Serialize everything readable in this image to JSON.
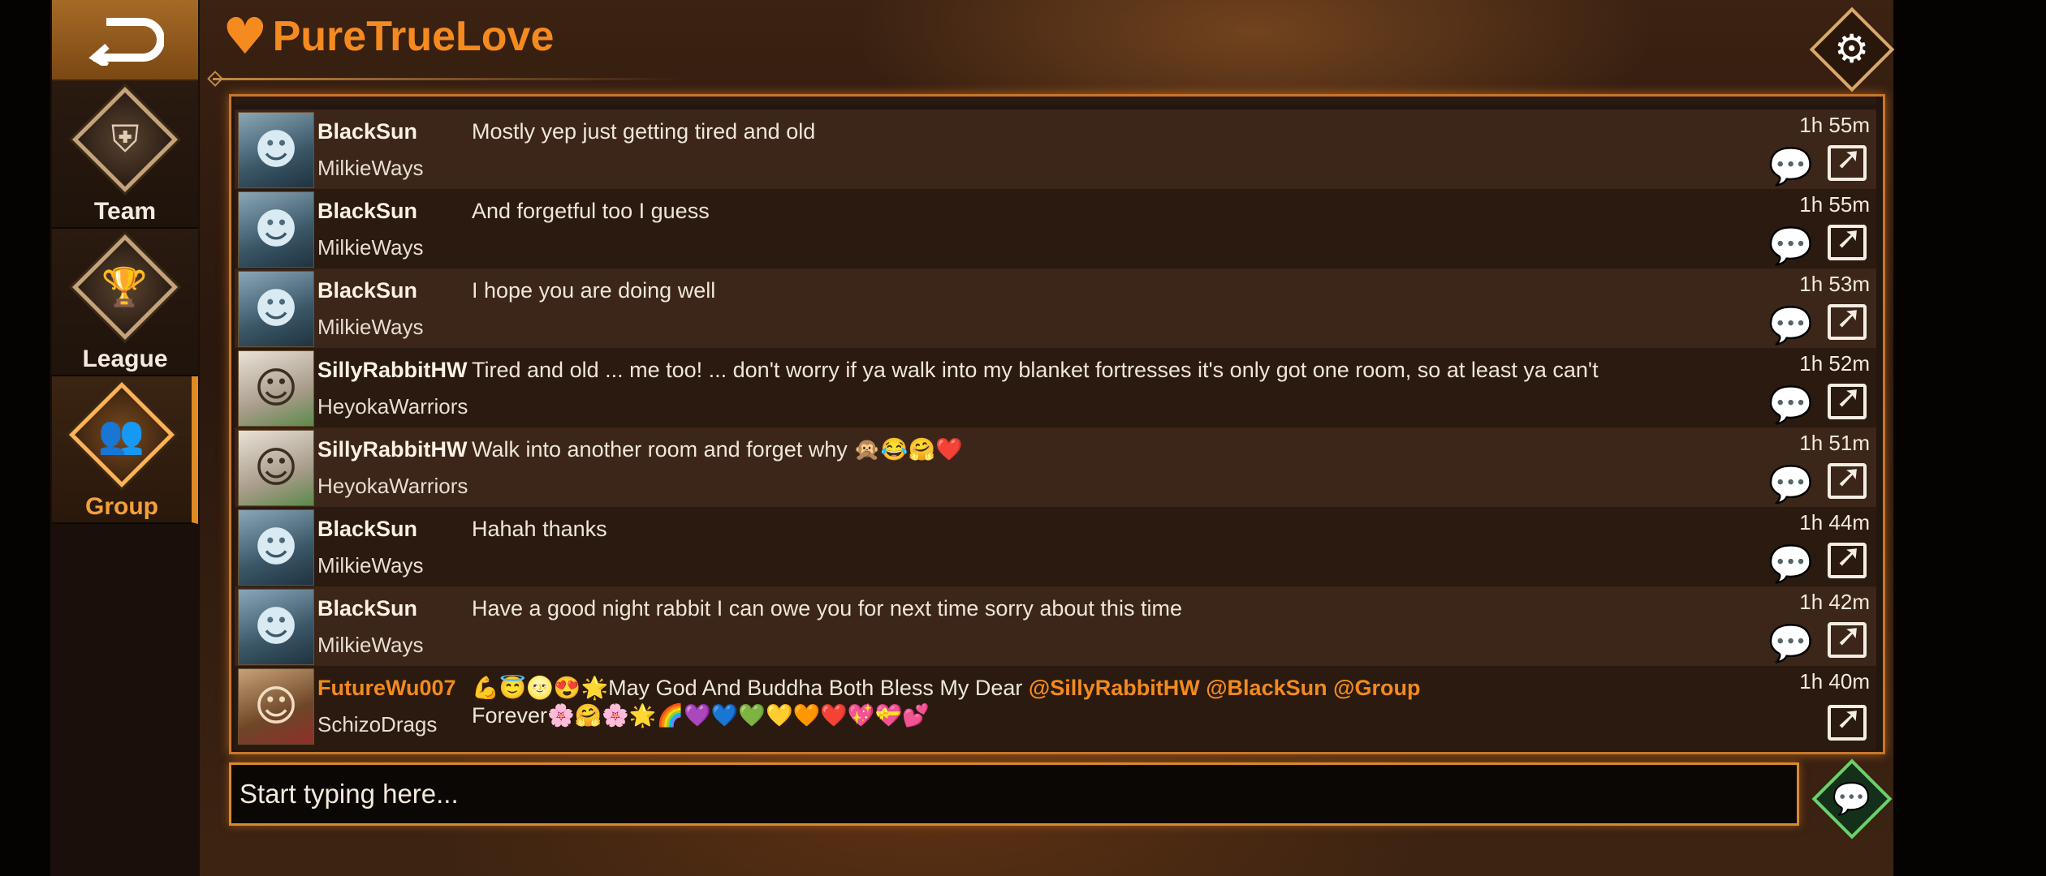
{
  "app": {
    "title": "PureTrueLove"
  },
  "sidebar": {
    "items": [
      {
        "label": "Team",
        "icon": "team-shield-icon",
        "glyph": "⛨",
        "active": false
      },
      {
        "label": "League",
        "icon": "trophy-icon",
        "glyph": "🏆",
        "active": false
      },
      {
        "label": "Group",
        "icon": "group-icon",
        "glyph": "👥",
        "active": true
      }
    ]
  },
  "colors": {
    "accent": "#f58a1f",
    "panel_border": "#c9762a",
    "send_green": "#6bd06b"
  },
  "messages": [
    {
      "user": "BlackSun",
      "group": "MilkieWays",
      "text": "Mostly yep just getting tired and old",
      "time": "1h 55m",
      "avatar": "blue"
    },
    {
      "user": "BlackSun",
      "group": "MilkieWays",
      "text": "And forgetful too I guess",
      "time": "1h 55m",
      "avatar": "blue"
    },
    {
      "user": "BlackSun",
      "group": "MilkieWays",
      "text": "I hope you are doing well",
      "time": "1h 53m",
      "avatar": "blue"
    },
    {
      "user": "SillyRabbitHW",
      "group": "HeyokaWarriors",
      "text": "Tired and old ... me too! ... don't worry if ya walk into my blanket fortresses it's only got one room, so at least ya can't",
      "time": "1h 52m",
      "avatar": "white"
    },
    {
      "user": "SillyRabbitHW",
      "group": "HeyokaWarriors",
      "text": "Walk into another room and forget why 🙊😂🤗❤️",
      "time": "1h 51m",
      "avatar": "white"
    },
    {
      "user": "BlackSun",
      "group": "MilkieWays",
      "text": "Hahah thanks",
      "time": "1h 44m",
      "avatar": "blue"
    },
    {
      "user": "BlackSun",
      "group": "MilkieWays",
      "text": "Have a good night rabbit  I can owe you for next time sorry about this time",
      "time": "1h 42m",
      "avatar": "blue"
    }
  ],
  "last_message": {
    "user": "FutureWu007",
    "group": "SchizoDrags",
    "text_line1": "💪😇🌝😍🌟May God And Buddha Both Bless My Dear ",
    "mention1": "@SillyRabbitHW",
    "mention2": "@BlackSun",
    "mention3": "@Group",
    "text_line2": "Forever🌸🤗🌸🌟🌈💜💙💚💛🧡❤️💖💝💕",
    "time": "1h 40m"
  },
  "composer": {
    "placeholder": "Start typing here..."
  }
}
